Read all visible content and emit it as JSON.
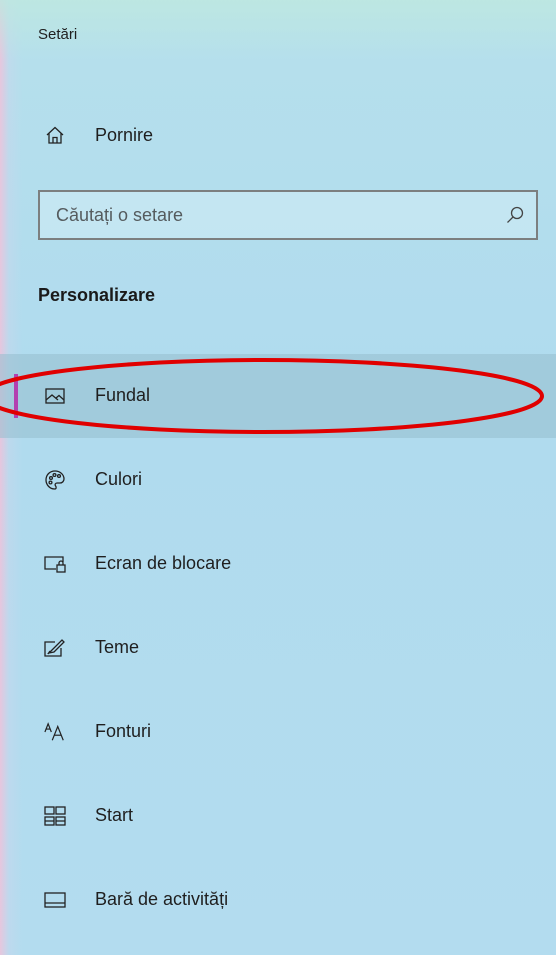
{
  "window": {
    "title": "Setări"
  },
  "home": {
    "label": "Pornire",
    "icon": "home-icon"
  },
  "search": {
    "placeholder": "Căutați o setare",
    "value": "",
    "icon": "search-icon"
  },
  "section": {
    "heading": "Personalizare"
  },
  "nav": {
    "items": [
      {
        "label": "Fundal",
        "icon": "picture-icon",
        "selected": true
      },
      {
        "label": "Culori",
        "icon": "palette-icon",
        "selected": false
      },
      {
        "label": "Ecran de blocare",
        "icon": "lock-screen-icon",
        "selected": false
      },
      {
        "label": "Teme",
        "icon": "themes-icon",
        "selected": false
      },
      {
        "label": "Fonturi",
        "icon": "fonts-icon",
        "selected": false
      },
      {
        "label": "Start",
        "icon": "start-icon",
        "selected": false
      },
      {
        "label": "Bară de activități",
        "icon": "taskbar-icon",
        "selected": false
      }
    ]
  },
  "colors": {
    "accent": "#b340b0",
    "annotation": "#e00000",
    "background": "#b3dcee"
  }
}
